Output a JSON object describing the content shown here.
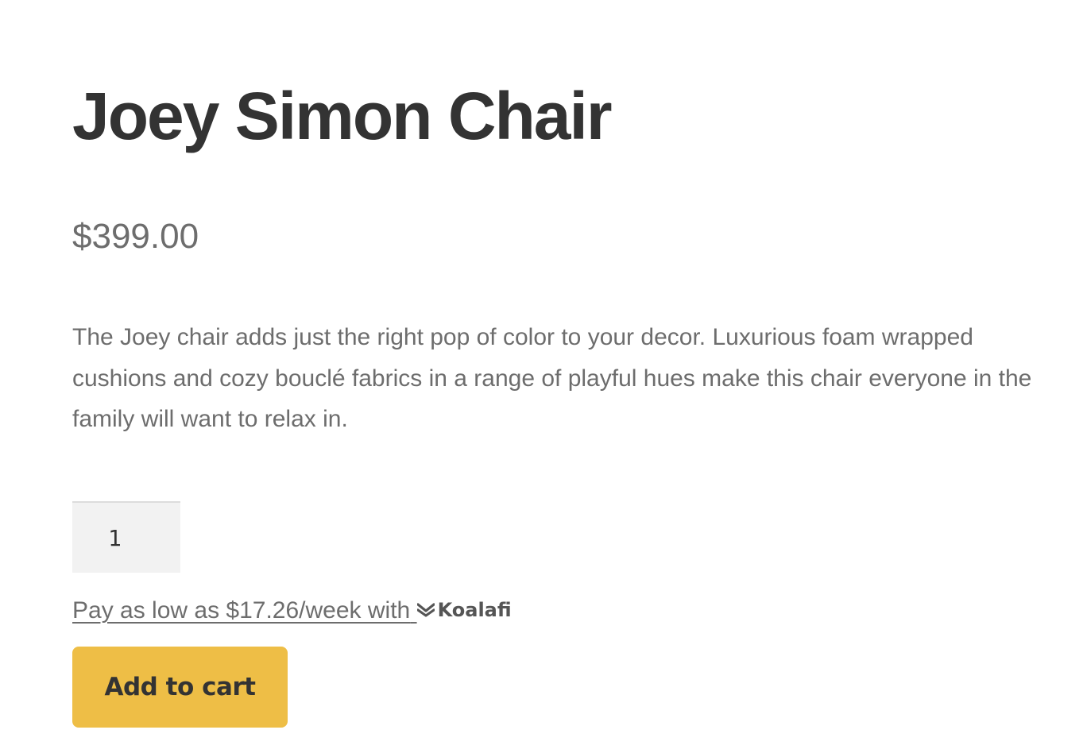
{
  "product": {
    "title": "Joey Simon Chair",
    "price": "$399.00",
    "description": "The Joey chair adds just the right pop of color to your decor. Luxurious foam wrapped cushions and cozy bouclé fabrics in a range of playful hues make this chair everyone in the family will want to relax in.",
    "quantity": "1"
  },
  "financing": {
    "text": "Pay as low as $17.26/week with",
    "brand": "Koalafi",
    "brand_icon": "koalafi-logo-icon"
  },
  "actions": {
    "add_to_cart_label": "Add to cart"
  },
  "colors": {
    "button_background": "#eebe46",
    "title_text": "#333333",
    "body_text": "#6d6d6d",
    "input_background": "#f2f2f2"
  }
}
